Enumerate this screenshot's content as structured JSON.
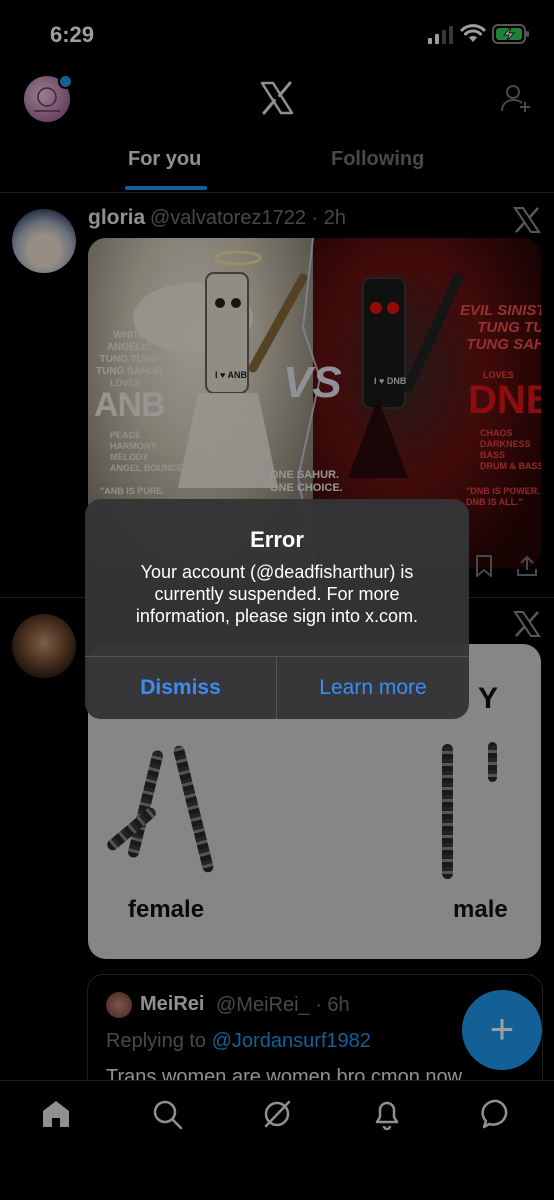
{
  "status_bar": {
    "time": "6:29"
  },
  "header": {
    "tabs": [
      {
        "label": "For you"
      },
      {
        "label": "Following"
      }
    ]
  },
  "post1": {
    "name": "gloria",
    "handle_time": "@valvatorez1722 · 2h",
    "image": {
      "left_title": "WHITE\nANGELIC\nTUNG TUNG\nTUNG SAHUR",
      "left_loves": "LOVES",
      "left_big": "ANB",
      "left_list": "PEACE\nHARMONY\nMELODY\nANGEL BOUNCE",
      "left_quote": "\"ANB IS PURE.",
      "shirt_left": "I ♥ ANB",
      "vs": "VS",
      "center_bottom": "ONE SAHUR.\nONE CHOICE.",
      "right_title": "EVIL SINISTER\nTUNG TUNG\nTUNG SAHUR",
      "right_loves": "LOVES",
      "right_big": "DNB",
      "right_list": "CHAOS\nDARKNESS\nBASS\nDRUM & BASS",
      "right_quote": "\"DNB IS POWER.\nDNB IS ALL.\"",
      "shirt_right": "I ♥ DNB"
    }
  },
  "post2": {
    "image": {
      "label_y": "Y",
      "label_female": "female",
      "label_male": "male"
    },
    "quote": {
      "name": "MeiRei",
      "handle_time": "@MeiRei_ · 6h",
      "replying_prefix": "Replying to ",
      "replying_to": "@Jordansurf1982",
      "text": "Trans women are women bro cmon now"
    }
  },
  "fab": {
    "label": "+"
  },
  "alert": {
    "title": "Error",
    "message": "Your account (@deadfisharthur) is currently suspended. For more information, please sign into x.com.",
    "dismiss": "Dismiss",
    "learn_more": "Learn more"
  },
  "colors": {
    "accent": "#1d9bf0",
    "alert_bg": "#343436",
    "alert_button": "#3b8cf5",
    "background": "#000000"
  },
  "icons": {
    "bottom_nav": [
      "home-icon",
      "search-icon",
      "grok-icon",
      "notifications-icon",
      "messages-icon"
    ],
    "header": [
      "avatar",
      "x-logo-icon",
      "add-follow-icon"
    ]
  }
}
